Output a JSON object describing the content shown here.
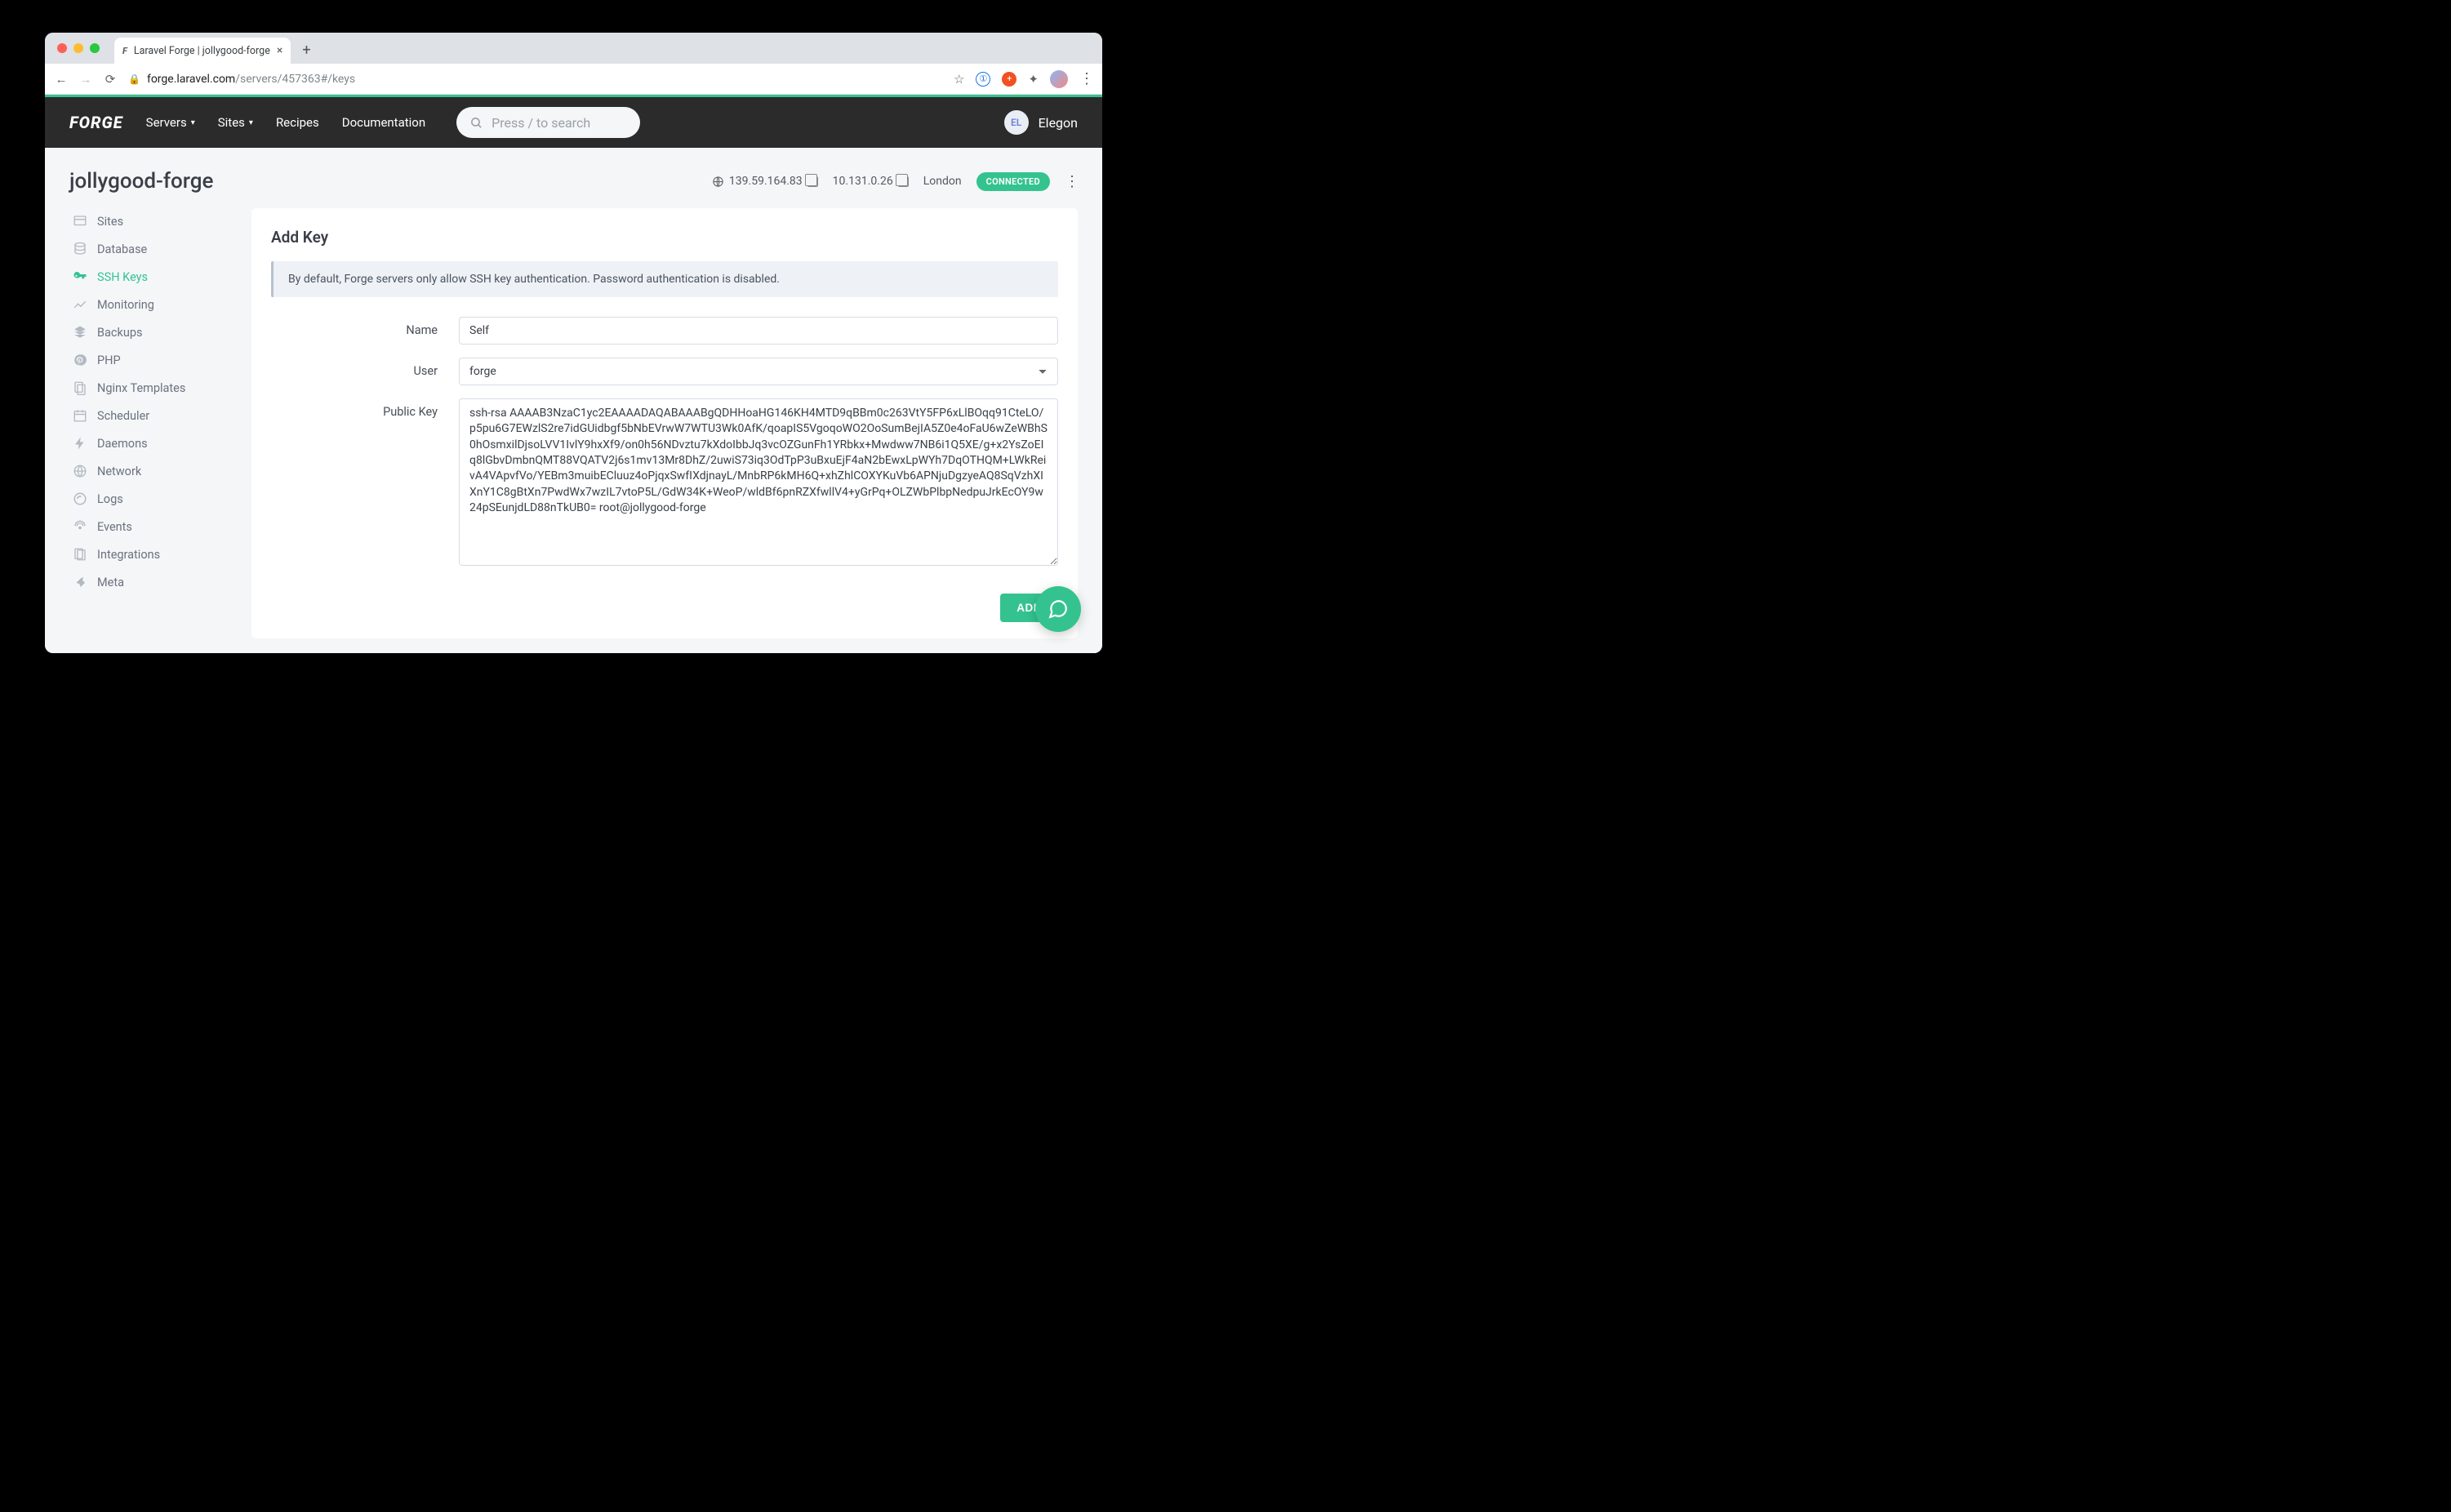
{
  "browser": {
    "tab_title": "Laravel Forge | jollygood-forge",
    "url_host": "forge.laravel.com",
    "url_path": "/servers/457363#/keys"
  },
  "header": {
    "logo": "FORGE",
    "nav": {
      "servers": "Servers",
      "sites": "Sites",
      "recipes": "Recipes",
      "docs": "Documentation"
    },
    "search_placeholder": "Press / to search",
    "user_initials": "EL",
    "user_name": "Elegon"
  },
  "server": {
    "name": "jollygood-forge",
    "public_ip": "139.59.164.83",
    "private_ip": "10.131.0.26",
    "region": "London",
    "status": "CONNECTED"
  },
  "sidebar": {
    "items": [
      {
        "key": "sites",
        "label": "Sites"
      },
      {
        "key": "database",
        "label": "Database"
      },
      {
        "key": "ssh-keys",
        "label": "SSH Keys",
        "active": true
      },
      {
        "key": "monitoring",
        "label": "Monitoring"
      },
      {
        "key": "backups",
        "label": "Backups"
      },
      {
        "key": "php",
        "label": "PHP"
      },
      {
        "key": "nginx",
        "label": "Nginx Templates"
      },
      {
        "key": "scheduler",
        "label": "Scheduler"
      },
      {
        "key": "daemons",
        "label": "Daemons"
      },
      {
        "key": "network",
        "label": "Network"
      },
      {
        "key": "logs",
        "label": "Logs"
      },
      {
        "key": "events",
        "label": "Events"
      },
      {
        "key": "integrations",
        "label": "Integrations"
      },
      {
        "key": "meta",
        "label": "Meta"
      }
    ]
  },
  "card": {
    "title": "Add Key",
    "info": "By default, Forge servers only allow SSH key authentication. Password authentication is disabled.",
    "labels": {
      "name": "Name",
      "user": "User",
      "pubkey": "Public Key"
    },
    "name_value": "Self",
    "user_value": "forge",
    "pubkey_value": "ssh-rsa AAAAB3NzaC1yc2EAAAADAQABAAABgQDHHoaHG146KH4MTD9qBBm0c263VtY5FP6xLlBOqq91CteLO/p5pu6G7EWzlS2re7idGUidbgf5bNbEVrwW7WTU3Wk0AfK/qoapIS5VgoqoWO2OoSumBejIA5Z0e4oFaU6wZeWBhS0hOsmxilDjsoLVV1IvlY9hxXf9/on0h56NDvztu7kXdoIbbJq3vcOZGunFh1YRbkx+Mwdww7NB6i1Q5XE/g+x2YsZoEIq8lGbvDmbnQMT88VQATV2j6s1mv13Mr8DhZ/2uwiS73iq3OdTpP3uBxuEjF4aN2bEwxLpWYh7DqOTHQM+LWkReivA4VApvfVo/YEBm3muibECluuz4oPjqxSwfIXdjnayL/MnbRP6kMH6Q+xhZhlCOXYKuVb6APNjuDgzyeAQ8SqVzhXIXnY1C8gBtXn7PwdWx7wzIL7vtoP5L/GdW34K+WeoP/wldBf6pnRZXfwllV4+yGrPq+OLZWbPlbpNedpuJrkEcOY9w24pSEunjdLD88nTkUB0= root@jollygood-forge",
    "add_button": "ADD"
  }
}
